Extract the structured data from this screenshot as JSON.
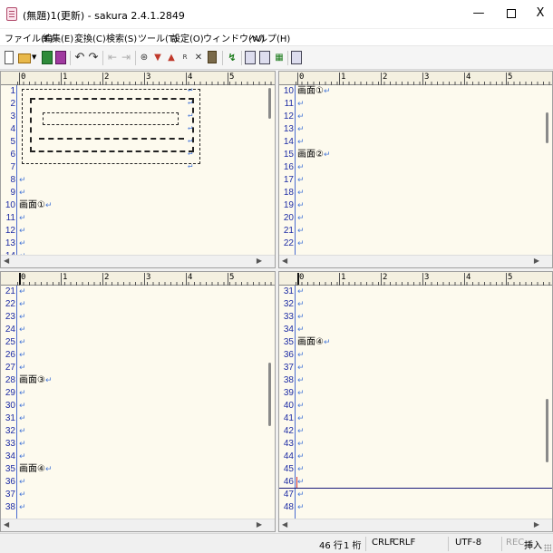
{
  "window": {
    "title": "(無題)1(更新) - sakura 2.4.1.2849",
    "min_label": "—",
    "close_label": "X"
  },
  "menu": [
    "ファイル(F)",
    "編集(E)",
    "変換(C)",
    "検索(S)",
    "ツール(T)",
    "設定(O)",
    "ウィンドウ(W)",
    "ヘルプ(H)"
  ],
  "toolbar": {
    "undo_icon": "↶",
    "redo_icon": "↷",
    "find_icon": "⊛",
    "icons": [
      "new-file-icon",
      "open-file-icon",
      "dropdown-icon",
      "save-icon",
      "save-all-icon",
      "undo-icon",
      "redo-icon",
      "prev-bookmark-icon",
      "next-bookmark-icon",
      "find-icon",
      "find-next-icon",
      "find-prev-icon",
      "replace-icon",
      "clear-search-icon",
      "grep-icon",
      "jump-icon",
      "compare-icon",
      "outline-icon",
      "type-settings-icon",
      "window-list-icon"
    ]
  },
  "ruler": {
    "labels": [
      "0",
      "1",
      "2",
      "3",
      "4",
      "5"
    ]
  },
  "eol_mark": "↵",
  "panes": {
    "top_left": {
      "start": 1,
      "lines": [
        "",
        "",
        "",
        "",
        "",
        "",
        "",
        "",
        "",
        "画面①",
        "",
        "",
        "",
        ""
      ]
    },
    "top_right": {
      "start": 10,
      "lines": [
        "画面①",
        "",
        "",
        "",
        "",
        "画面②",
        "",
        "",
        "",
        "",
        "",
        "",
        ""
      ]
    },
    "bottom_left": {
      "start": 21,
      "lines": [
        "",
        "",
        "",
        "",
        "",
        "",
        "",
        "画面③",
        "",
        "",
        "",
        "",
        "",
        "",
        "画面④",
        "",
        "",
        ""
      ]
    },
    "bottom_right": {
      "start": 31,
      "lines": [
        "",
        "",
        "",
        "",
        "画面④",
        "",
        "",
        "",
        "",
        "",
        "",
        "",
        "",
        "",
        "",
        "",
        "",
        ""
      ]
    }
  },
  "status": {
    "line": "46 行",
    "col": "1 桁",
    "eol1": "CRLF",
    "eol2": "CRLF",
    "encoding": "UTF-8",
    "rec": "REC",
    "mode": "挿入"
  }
}
